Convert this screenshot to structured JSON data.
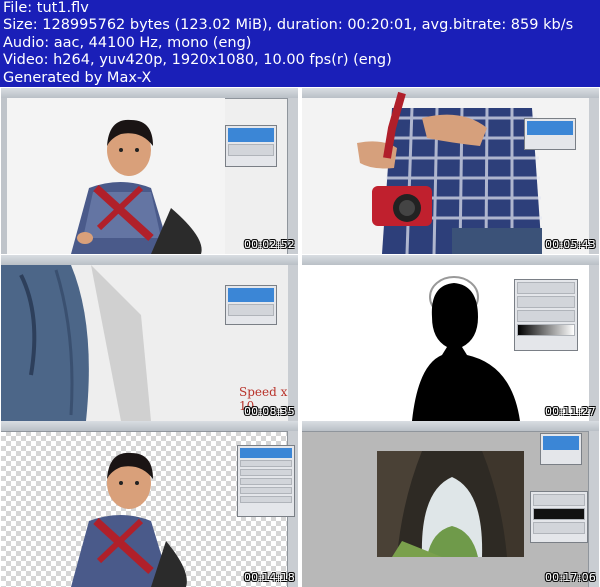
{
  "header": {
    "file": "File: tut1.flv",
    "size": "Size: 128995762 bytes (123.02 MiB), duration: 00:20:01, avg.bitrate: 859 kb/s",
    "audio": "Audio: aac, 44100 Hz, mono (eng)",
    "video": "Video: h264, yuv420p, 1920x1080, 10.00 fps(r) (eng)",
    "generator": "Generated by Max-X"
  },
  "thumbnails": [
    {
      "timestamp": "00:02:52"
    },
    {
      "timestamp": "00:05:43"
    },
    {
      "timestamp": "00:08:35",
      "overlay": "Speed x 10"
    },
    {
      "timestamp": "00:11:27"
    },
    {
      "timestamp": "00:14:18"
    },
    {
      "timestamp": "00:17:06"
    }
  ],
  "colors": {
    "background": "#1a1fb8",
    "header_text": "#ffffff",
    "selection_blue": "#3b86d6"
  }
}
